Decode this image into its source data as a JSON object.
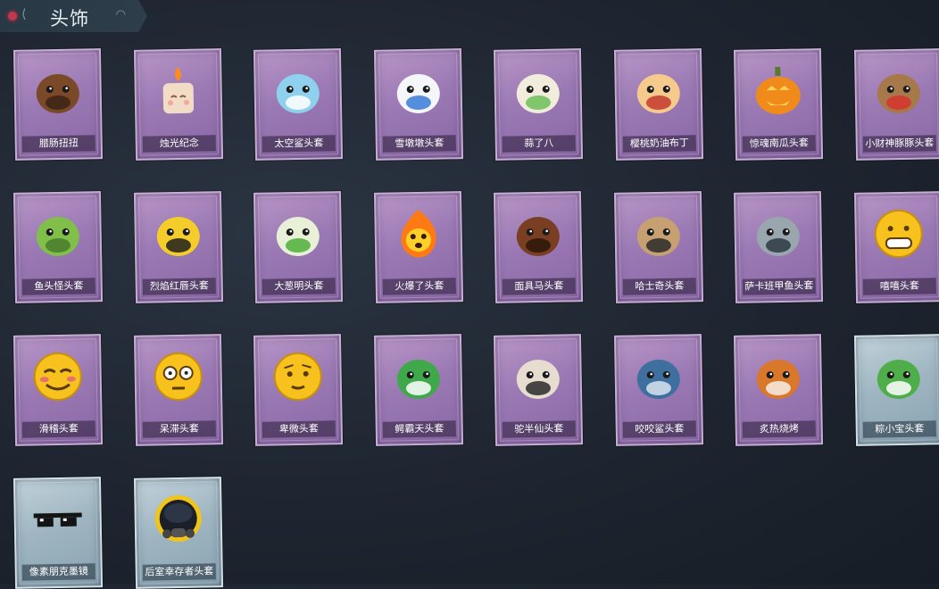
{
  "header": {
    "title": "头饰"
  },
  "items": [
    {
      "name": "腊肠扭扭",
      "icon": "dog-head-icon",
      "color": "#7a4a28",
      "accent": "#3b2315",
      "rarity": "purple"
    },
    {
      "name": "烛光纪念",
      "icon": "candle-head-icon",
      "color": "#f2dcc6",
      "accent": "#ff8a1e",
      "rarity": "purple"
    },
    {
      "name": "太空鲨头套",
      "icon": "space-shark-icon",
      "color": "#8fd0ee",
      "accent": "#ffffff",
      "rarity": "purple"
    },
    {
      "name": "雪墩墩头套",
      "icon": "snowman-head-icon",
      "color": "#f4f6fa",
      "accent": "#3a7bd8",
      "rarity": "purple"
    },
    {
      "name": "蒜了八",
      "icon": "garlic-head-icon",
      "color": "#f1ecdc",
      "accent": "#6bbf59",
      "rarity": "purple"
    },
    {
      "name": "樱桃奶油布丁",
      "icon": "pudding-head-icon",
      "color": "#f6c98d",
      "accent": "#c43a2e",
      "rarity": "purple"
    },
    {
      "name": "惊魂南瓜头套",
      "icon": "pumpkin-head-icon",
      "color": "#f08a1a",
      "accent": "#ffd35a",
      "rarity": "purple"
    },
    {
      "name": "小财神豚豚头套",
      "icon": "capybara-head-icon",
      "color": "#a7784a",
      "accent": "#d6342c",
      "rarity": "purple"
    },
    {
      "name": "鱼头怪头套",
      "icon": "fish-monster-icon",
      "color": "#7fbf4a",
      "accent": "#4a7a2a",
      "rarity": "purple"
    },
    {
      "name": "烈焰红唇头套",
      "icon": "pikachu-head-icon",
      "color": "#f5cd2a",
      "accent": "#1e1e1e",
      "rarity": "purple"
    },
    {
      "name": "大葱明头套",
      "icon": "scallion-head-icon",
      "color": "#e8f0d8",
      "accent": "#4caf3a",
      "rarity": "purple"
    },
    {
      "name": "火爆了头套",
      "icon": "fire-head-icon",
      "color": "#ff7a12",
      "accent": "#ffd02a",
      "rarity": "purple"
    },
    {
      "name": "面具马头套",
      "icon": "horse-head-icon",
      "color": "#7a3f22",
      "accent": "#2b160b",
      "rarity": "purple"
    },
    {
      "name": "哈士奇头套",
      "icon": "husky-head-icon",
      "color": "#c7a071",
      "accent": "#2a2a2a",
      "rarity": "purple"
    },
    {
      "name": "萨卡班甲鱼头套",
      "icon": "sacabambaspis-icon",
      "color": "#9aa6ad",
      "accent": "#2d3a44",
      "rarity": "purple"
    },
    {
      "name": "嘻嘻头套",
      "icon": "grin-emoji-icon",
      "color": "#f7c21e",
      "accent": "#ffffff",
      "rarity": "purple"
    },
    {
      "name": "滑稽头套",
      "icon": "funny-emoji-icon",
      "color": "#f7c21e",
      "accent": "#e8716e",
      "rarity": "purple"
    },
    {
      "name": "呆滞头套",
      "icon": "dazed-emoji-icon",
      "color": "#f7c21e",
      "accent": "#ffffff",
      "rarity": "purple"
    },
    {
      "name": "卑微头套",
      "icon": "humble-emoji-icon",
      "color": "#f7c21e",
      "accent": "#8a5a10",
      "rarity": "purple"
    },
    {
      "name": "鳄霸天头套",
      "icon": "crocodile-head-icon",
      "color": "#3fa84a",
      "accent": "#ffffff",
      "rarity": "purple"
    },
    {
      "name": "驼半仙头套",
      "icon": "alpaca-head-icon",
      "color": "#e6dcd0",
      "accent": "#2a2a2a",
      "rarity": "purple"
    },
    {
      "name": "咬咬鲨头套",
      "icon": "bite-shark-icon",
      "color": "#3f6f9e",
      "accent": "#d8e4ee",
      "rarity": "purple"
    },
    {
      "name": "炙热烧烤",
      "icon": "bbq-meat-icon",
      "color": "#d9782a",
      "accent": "#f4efe6",
      "rarity": "purple"
    },
    {
      "name": "粽小宝头套",
      "icon": "zongzi-head-icon",
      "color": "#4fae4a",
      "accent": "#ffffff",
      "rarity": "blue"
    },
    {
      "name": "像素朋克墨镜",
      "icon": "pixel-sunglasses-icon",
      "color": "#141414",
      "accent": "#ffffff",
      "rarity": "blue"
    },
    {
      "name": "后室幸存者头套",
      "icon": "hazmat-helmet-icon",
      "color": "#1b1f28",
      "accent": "#f0c419",
      "rarity": "blue"
    }
  ]
}
